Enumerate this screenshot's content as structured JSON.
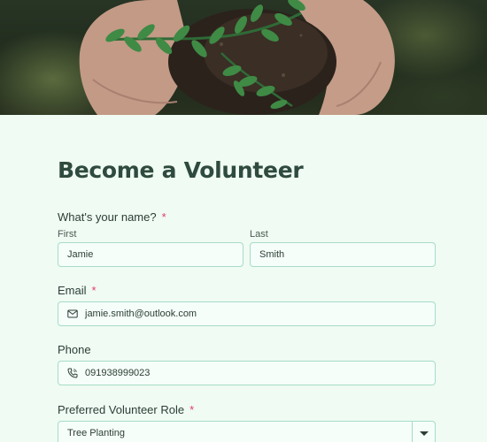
{
  "form": {
    "title": "Become a Volunteer",
    "required_marker": "*",
    "name": {
      "label": "What's your name?",
      "first_label": "First",
      "first_value": "Jamie",
      "last_label": "Last",
      "last_value": "Smith"
    },
    "email": {
      "label": "Email",
      "value": "jamie.smith@outlook.com",
      "icon": "envelope-icon"
    },
    "phone": {
      "label": "Phone",
      "value": "091938999023",
      "icon": "phone-icon"
    },
    "role": {
      "label": "Preferred Volunteer Role",
      "value": "Tree Planting",
      "icon": "chevron-down-icon"
    }
  },
  "colors": {
    "background": "#effbf3",
    "title": "#2f4a3e",
    "field_border": "#a6dcc8",
    "required": "#e63c6a"
  }
}
